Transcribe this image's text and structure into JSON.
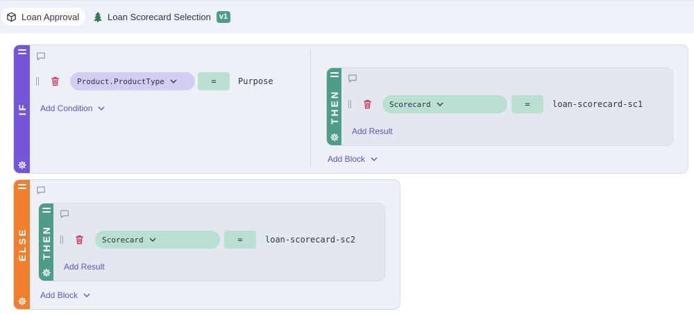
{
  "breadcrumb": {
    "item1": "Loan Approval",
    "item2": "Loan Scorecard Selection",
    "version": "v1"
  },
  "if_block": {
    "label": "IF",
    "condition": {
      "field": "Product.ProductType",
      "operator": "=",
      "value": "Purpose"
    },
    "add_condition": "Add Condition"
  },
  "then_block_1": {
    "label": "THEN",
    "result": {
      "field": "Scorecard",
      "operator": "=",
      "value": "loan-scorecard-sc1"
    },
    "add_result": "Add Result"
  },
  "if_add_block": "Add Block",
  "else_block": {
    "label": "ELSE",
    "add_block": "Add Block"
  },
  "then_block_2": {
    "label": "THEN",
    "result": {
      "field": "Scorecard",
      "operator": "=",
      "value": "loan-scorecard-sc2"
    },
    "add_result": "Add Result"
  },
  "colors": {
    "if_bar": "#7456d6",
    "then_bar": "#4e9e87",
    "else_bar": "#ef7f2c",
    "link": "#5b54c4",
    "delete": "#d6304f"
  }
}
